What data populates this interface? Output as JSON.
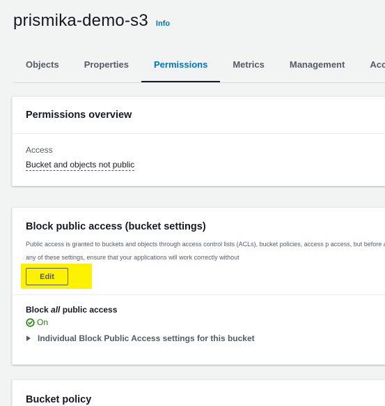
{
  "header": {
    "bucket_name": "prismika-demo-s3",
    "info_label": "Info"
  },
  "tabs": [
    {
      "label": "Objects",
      "active": false
    },
    {
      "label": "Properties",
      "active": false
    },
    {
      "label": "Permissions",
      "active": true
    },
    {
      "label": "Metrics",
      "active": false
    },
    {
      "label": "Management",
      "active": false
    },
    {
      "label": "Acce",
      "active": false
    }
  ],
  "overview": {
    "title": "Permissions overview",
    "access_label": "Access",
    "access_value": "Bucket and objects not public"
  },
  "block_public_access": {
    "title": "Block public access (bucket settings)",
    "description": "Public access is granted to buckets and objects through access control lists (ACLs), bucket policies, access p access, but before applying any of these settings, ensure that your applications will work correctly without",
    "edit_label": "Edit",
    "block_all_prefix": "Block ",
    "block_all_em": "all",
    "block_all_suffix": " public access",
    "status": "On",
    "expander_label": "Individual Block Public Access settings for this bucket"
  },
  "bucket_policy": {
    "title": "Bucket policy"
  },
  "colors": {
    "accent": "#0073bb",
    "success": "#1d8102",
    "highlight": "#fff200"
  }
}
